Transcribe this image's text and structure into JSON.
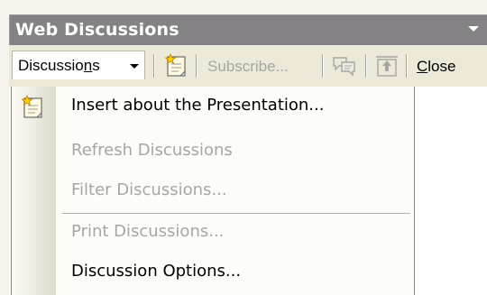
{
  "pane": {
    "title": "Web Discussions"
  },
  "toolbar": {
    "discussions_label": "Discussions",
    "subscribe_label": "Subscribe...",
    "close_label": "Close"
  },
  "menu": {
    "items": [
      {
        "label": "Insert about the Presentation...",
        "enabled": true,
        "icon": "insert-discussion-icon"
      },
      {
        "label": "Refresh Discussions",
        "enabled": false
      },
      {
        "label": "Filter Discussions...",
        "enabled": false
      },
      {
        "label": "Print Discussions...",
        "enabled": false
      },
      {
        "label": "Discussion Options...",
        "enabled": true
      }
    ]
  },
  "colors": {
    "title_bar": "#848284",
    "toolbar": "#ece9d8",
    "disabled_text": "#a7a6a0"
  }
}
